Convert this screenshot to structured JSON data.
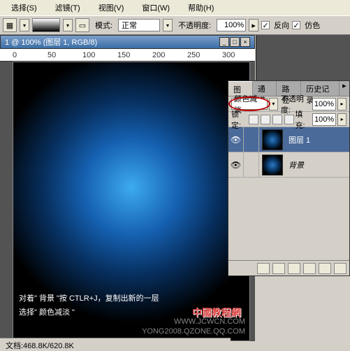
{
  "menu": {
    "select": "选择(S)",
    "filter": "滤镜(T)",
    "view": "视图(V)",
    "window": "窗口(W)",
    "help": "帮助(H)"
  },
  "toolbar": {
    "mode_label": "模式:",
    "mode_value": "正常",
    "opacity_label": "不透明度:",
    "opacity_value": "100%",
    "arrow": "▸",
    "reverse": "反向",
    "dither": "仿色",
    "check": "✓"
  },
  "doc": {
    "title": "1 @ 100% (图层 1, RGB/8)"
  },
  "ruler": {
    "r0": "0",
    "r50": "50",
    "r100": "100",
    "r150": "150",
    "r200": "200",
    "r250": "250",
    "r300": "300"
  },
  "caption": {
    "line1": "对着\" 背景 \"按 CTLR+J，复制出新的一层",
    "line2": "选择\" 颜色减淡 \""
  },
  "status": "文档:468.8K/620.8K",
  "panel": {
    "tab_layers": "图层",
    "tab_channels": "通道",
    "tab_paths": "路径",
    "tab_history": "历史记录",
    "blend": "颜色减淡",
    "opacity_label": "不透明度:",
    "opacity": "100%",
    "lock_label": "锁定:",
    "fill_label": "填充:",
    "fill": "100%",
    "layer1": "图层 1",
    "bg": "背景",
    "eye": "👁",
    "italic": "斜体"
  },
  "watermark": {
    "site": "中國教程網",
    "url": "WWW.JCWCN.COM",
    "sub": "YONG2008.QZONE.QQ.COM"
  }
}
